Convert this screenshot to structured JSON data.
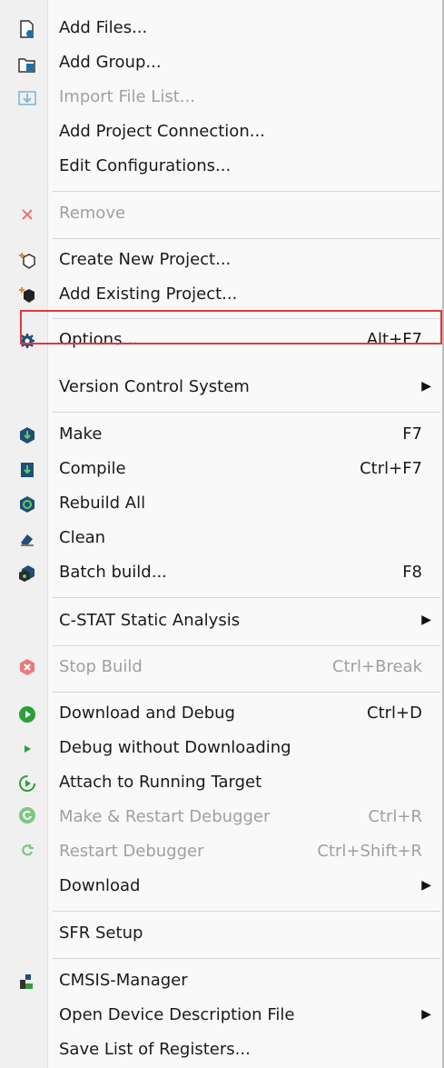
{
  "menu": {
    "add_files": {
      "label": "Add Files..."
    },
    "add_group": {
      "label": "Add Group..."
    },
    "import_file_list": {
      "label": "Import File List..."
    },
    "add_project_connection": {
      "label": "Add Project Connection..."
    },
    "edit_configurations": {
      "label": "Edit Configurations..."
    },
    "remove": {
      "label": "Remove"
    },
    "create_new_project": {
      "label": "Create New Project..."
    },
    "add_existing_project": {
      "label": "Add Existing Project..."
    },
    "options": {
      "label": "Options...",
      "shortcut": "Alt+F7"
    },
    "version_control_system": {
      "label": "Version Control System"
    },
    "make": {
      "label": "Make",
      "shortcut": "F7"
    },
    "compile": {
      "label": "Compile",
      "shortcut": "Ctrl+F7"
    },
    "rebuild_all": {
      "label": "Rebuild All"
    },
    "clean": {
      "label": "Clean"
    },
    "batch_build": {
      "label": "Batch build...",
      "shortcut": "F8"
    },
    "c_stat": {
      "label": "C-STAT Static Analysis"
    },
    "stop_build": {
      "label": "Stop Build",
      "shortcut": "Ctrl+Break"
    },
    "download_and_debug": {
      "label": "Download and Debug",
      "shortcut": "Ctrl+D"
    },
    "debug_without_downloading": {
      "label": "Debug without Downloading"
    },
    "attach_to_running_target": {
      "label": "Attach to Running Target"
    },
    "make_restart_debugger": {
      "label": "Make & Restart Debugger",
      "shortcut": "Ctrl+R"
    },
    "restart_debugger": {
      "label": "Restart Debugger",
      "shortcut": "Ctrl+Shift+R"
    },
    "download": {
      "label": "Download"
    },
    "sfr_setup": {
      "label": "SFR Setup"
    },
    "cmsis_manager": {
      "label": "CMSIS-Manager"
    },
    "open_device_description_file": {
      "label": "Open Device Description File"
    },
    "save_list_of_registers": {
      "label": "Save List of Registers..."
    }
  },
  "colors": {
    "highlight_border": "#e0393e",
    "icon_blue": "#1f6ea8",
    "icon_green": "#2e9e3a",
    "stop_red": "#e05252"
  }
}
